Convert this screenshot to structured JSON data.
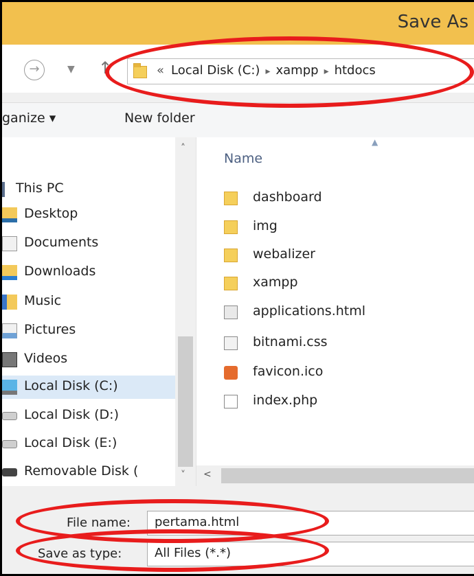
{
  "window": {
    "title": "Save As"
  },
  "nav": {
    "back_icon": "back-arrow-icon",
    "recent_icon": "chevron-down-icon",
    "up_icon": "up-arrow-icon",
    "address": {
      "overflow": "«",
      "crumbs": [
        "Local Disk (C:)",
        "xampp",
        "htdocs"
      ],
      "separator": "▸"
    }
  },
  "toolbar": {
    "organize": "ganize ▾",
    "new_folder": "New folder"
  },
  "sidebar": {
    "items": [
      {
        "label": "This PC",
        "icon": "pc-icon"
      },
      {
        "label": "Desktop",
        "icon": "desktop-icon"
      },
      {
        "label": "Documents",
        "icon": "documents-icon"
      },
      {
        "label": "Downloads",
        "icon": "downloads-icon"
      },
      {
        "label": "Music",
        "icon": "music-icon"
      },
      {
        "label": "Pictures",
        "icon": "pictures-icon"
      },
      {
        "label": "Videos",
        "icon": "videos-icon"
      },
      {
        "label": "Local Disk (C:)",
        "icon": "drive-c-icon",
        "selected": true
      },
      {
        "label": "Local Disk (D:)",
        "icon": "drive-icon"
      },
      {
        "label": "Local Disk (E:)",
        "icon": "drive-icon"
      },
      {
        "label": "Removable Disk (",
        "icon": "removable-drive-icon"
      }
    ]
  },
  "filelist": {
    "column_name": "Name",
    "items": [
      {
        "name": "dashboard",
        "type": "folder"
      },
      {
        "name": "img",
        "type": "folder"
      },
      {
        "name": "webalizer",
        "type": "folder"
      },
      {
        "name": "xampp",
        "type": "folder"
      },
      {
        "name": "applications.html",
        "type": "html"
      },
      {
        "name": "bitnami.css",
        "type": "css"
      },
      {
        "name": "favicon.ico",
        "type": "ico"
      },
      {
        "name": "index.php",
        "type": "php"
      }
    ]
  },
  "form": {
    "file_name_label": "File name:",
    "file_name_value": "pertama.html",
    "save_type_label": "Save as type:",
    "save_type_value": "All Files  (*.*)"
  },
  "colors": {
    "titlebar": "#f2c04e",
    "annotation_ellipse": "#e81c1c",
    "selection": "#dbe9f7"
  }
}
